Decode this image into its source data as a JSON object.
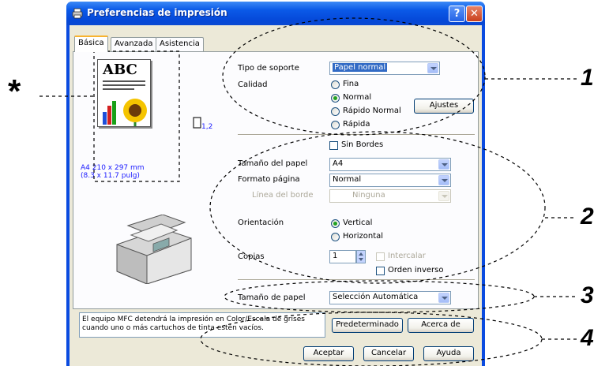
{
  "window": {
    "title": "Preferencias de impresión",
    "help_glyph": "?",
    "close_glyph": "✕"
  },
  "tabs": [
    "Básica",
    "Avanzada",
    "Asistencia"
  ],
  "preview": {
    "doc_text": "ABC",
    "paper_size_line1": "A4 210 x 297 mm",
    "paper_size_line2": "(8.3 x 11.7 pulg)",
    "copies_icon_label": "1,2"
  },
  "media": {
    "tipo_label": "Tipo de soporte",
    "tipo_value": "Papel normal",
    "calidad_label": "Calidad",
    "quality_options": [
      "Fina",
      "Normal",
      "Rápido Normal",
      "Rápida"
    ],
    "quality_selected": "Normal",
    "ajustes_button": "Ajustes"
  },
  "paper": {
    "sin_bordes_label": "Sin Bordes",
    "tamano_label": "Tamaño del papel",
    "tamano_value": "A4",
    "formato_label": "Formato página",
    "formato_value": "Normal",
    "linea_label": "Línea del borde",
    "linea_value": "Ninguna",
    "orientacion_label": "Orientación",
    "orientation_options": [
      "Vertical",
      "Horizontal"
    ],
    "orientation_selected": "Vertical",
    "copias_label": "Copias",
    "copias_value": "1",
    "intercalar_label": "Intercalar",
    "orden_label": "Orden inverso"
  },
  "source": {
    "tamano_de_papel_label": "Tamaño de papel",
    "tamano_de_papel_value": "Selección Automática"
  },
  "info_text_line1": "El equipo MFC detendrá la impresión en Color/Escala de grises",
  "info_text_line2": "cuando uno o más cartuchos de tinta estén vacíos.",
  "buttons": {
    "predeterminado": "Predeterminado",
    "acerca": "Acerca de",
    "aceptar": "Aceptar",
    "cancelar": "Cancelar",
    "ayuda": "Ayuda"
  },
  "annotations": [
    "*",
    "1",
    "2",
    "3",
    "4"
  ],
  "colors": {
    "titlebar": "#0548d8",
    "face": "#ece9d8",
    "selection": "#316ac5",
    "link_blue": "#1a1aff"
  }
}
